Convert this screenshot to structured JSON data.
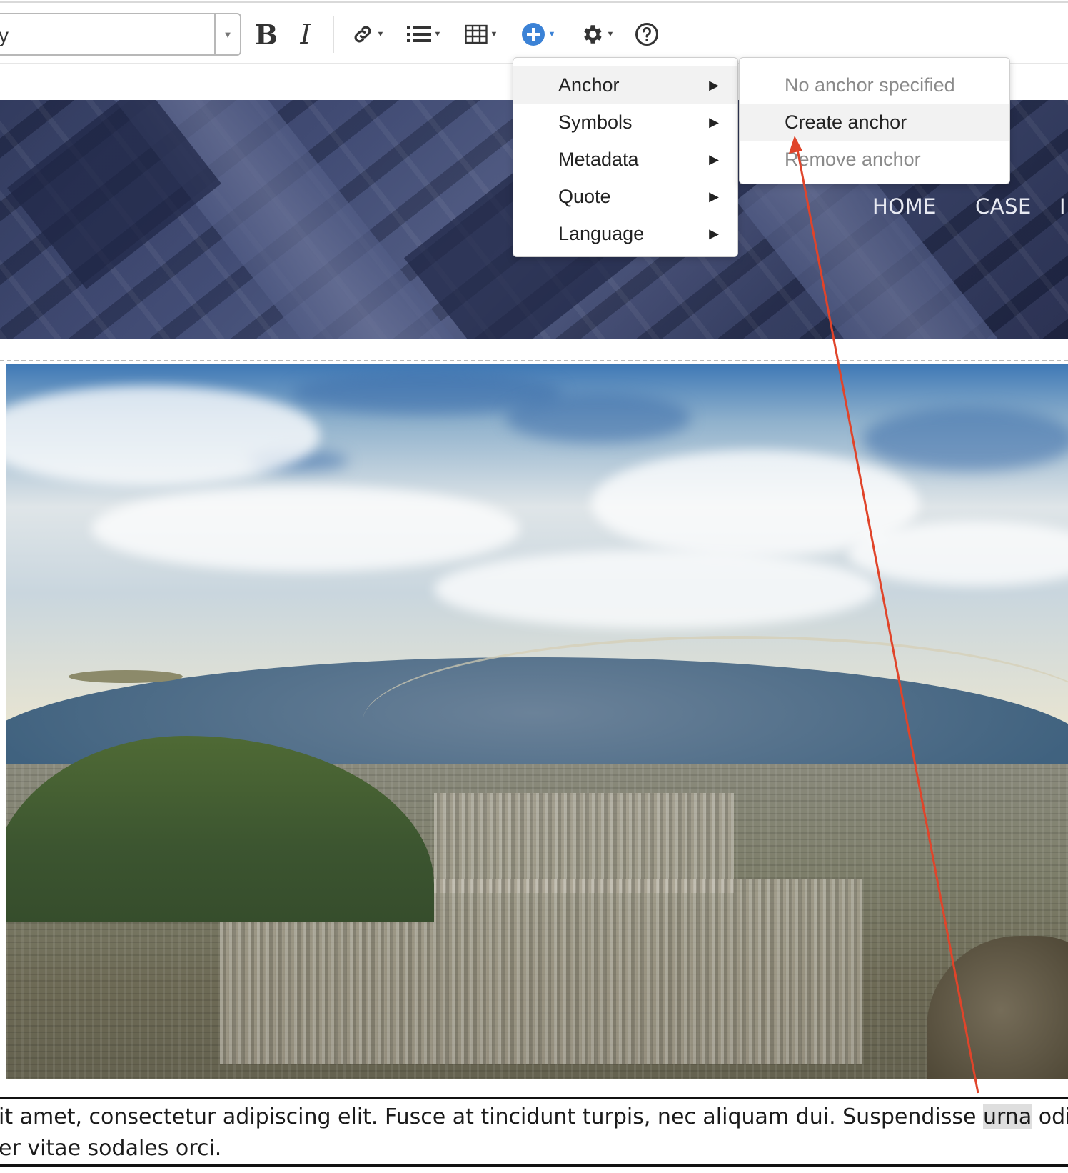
{
  "toolbar": {
    "style_value": "y",
    "bold_label": "B",
    "italic_label": "I"
  },
  "icons": {
    "link": "link-icon",
    "list": "list-icon",
    "table": "table-icon",
    "insert": "plus-circle-icon",
    "settings": "gear-icon",
    "help": "help-circle-icon"
  },
  "colors": {
    "insert_icon": "#3b82d6",
    "annotation_arrow": "#e0442a"
  },
  "header": {
    "nav": [
      "HOME",
      "CASE",
      "I"
    ]
  },
  "insert_menu": {
    "items": [
      {
        "label": "Anchor",
        "arrow": "▶"
      },
      {
        "label": "Symbols",
        "arrow": "▶"
      },
      {
        "label": "Metadata",
        "arrow": "▶"
      },
      {
        "label": "Quote",
        "arrow": "▶"
      },
      {
        "label": "Language",
        "arrow": "▶"
      }
    ]
  },
  "anchor_submenu": {
    "items": [
      {
        "label": "No anchor specified"
      },
      {
        "label": "Create anchor"
      },
      {
        "label": "Remove anchor"
      }
    ]
  },
  "body_text": {
    "line1_before": "it amet, consectetur adipiscing elit. Fusce at tincidunt turpis, nec aliquam dui. Suspendisse ",
    "line1_highlight": "urna",
    "line1_after": " odio,",
    "line2": "er vitae sodales orci."
  }
}
